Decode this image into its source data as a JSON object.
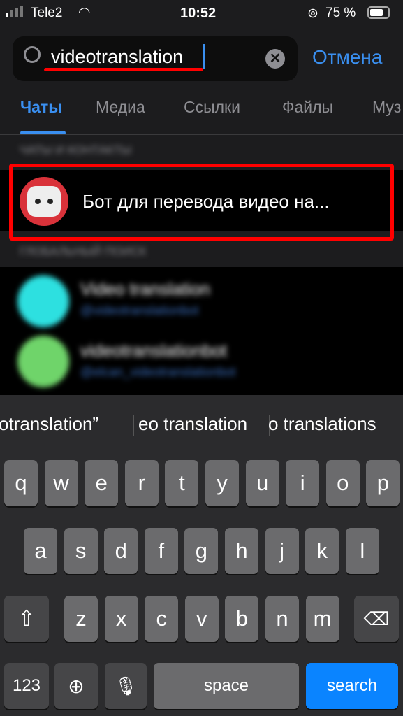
{
  "status": {
    "carrier": "Tele2",
    "time": "10:52",
    "battery": "75 %"
  },
  "search": {
    "value": "videotranslation",
    "cancel": "Отмена"
  },
  "tabs": [
    "Чаты",
    "Медиа",
    "Ссылки",
    "Файлы",
    "Муз"
  ],
  "sections": {
    "chats": "ЧАТЫ И КОНТАКТЫ",
    "global": "ГЛОБАЛЬНЫЙ ПОИСК"
  },
  "highlighted_chat": {
    "title": "Бот для перевода видео на..."
  },
  "global_results": [
    {
      "title": "Video translation",
      "handle": "@videotranslationbot",
      "color": "#2de0e0"
    },
    {
      "title": "videotranslationbot",
      "handle": "@elcan_videotranslationbot",
      "color": "#6fd46a"
    }
  ],
  "suggestions": [
    "otranslation”",
    "eo translation",
    "o translations"
  ],
  "keyboard": {
    "row1": [
      "q",
      "w",
      "e",
      "r",
      "t",
      "y",
      "u",
      "i",
      "o",
      "p"
    ],
    "row2": [
      "a",
      "s",
      "d",
      "f",
      "g",
      "h",
      "j",
      "k",
      "l"
    ],
    "row3": [
      "z",
      "x",
      "c",
      "v",
      "b",
      "n",
      "m"
    ],
    "numbers": "123",
    "space": "space",
    "search": "search"
  },
  "colors": {
    "accent": "#3a8ff0",
    "annotation": "#ff0000"
  }
}
